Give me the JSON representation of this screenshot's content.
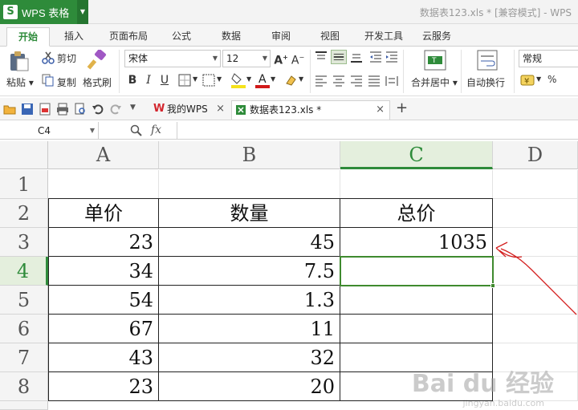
{
  "app": {
    "logo": "S",
    "name": "WPS 表格"
  },
  "title_bar": {
    "document_title": "数据表123.xls * [兼容模式] - WPS"
  },
  "ribbon_tabs": [
    "开始",
    "插入",
    "页面布局",
    "公式",
    "数据",
    "审阅",
    "视图",
    "开发工具",
    "云服务"
  ],
  "ribbon": {
    "paste": "粘贴",
    "cut": "剪切",
    "copy": "复制",
    "format_painter": "格式刷",
    "font_name": "宋体",
    "font_size": "12",
    "merge_center": "合并居中",
    "wrap_text": "自动换行",
    "number_format": "常规",
    "percent": "%",
    "font_color": "#d11a1a",
    "fill_color": "#f5e21b"
  },
  "doc_tabs": [
    {
      "label": "我的WPS",
      "icon": "wps-logo-icon"
    },
    {
      "label": "数据表123.xls *",
      "icon": "spreadsheet-file-icon"
    }
  ],
  "formula_bar": {
    "name_box": "C4",
    "fx": "fx",
    "formula": ""
  },
  "sheet": {
    "columns": [
      "A",
      "B",
      "C",
      "D"
    ],
    "rows": [
      "1",
      "2",
      "3",
      "4",
      "5",
      "6",
      "7",
      "8"
    ],
    "selected_cell": "C4",
    "cells": [
      [
        "",
        "",
        ""
      ],
      [
        "单价",
        "数量",
        "总价"
      ],
      [
        "23",
        "45",
        "1035"
      ],
      [
        "34",
        "7.5",
        ""
      ],
      [
        "54",
        "1.3",
        ""
      ],
      [
        "67",
        "11",
        ""
      ],
      [
        "43",
        "32",
        ""
      ],
      [
        "23",
        "20",
        ""
      ]
    ]
  },
  "watermark": {
    "text": "Bai du 经验",
    "url": "jingyan.baidu.com"
  },
  "accent_green": "#2e8b3a",
  "annotation_color": "#d42020"
}
